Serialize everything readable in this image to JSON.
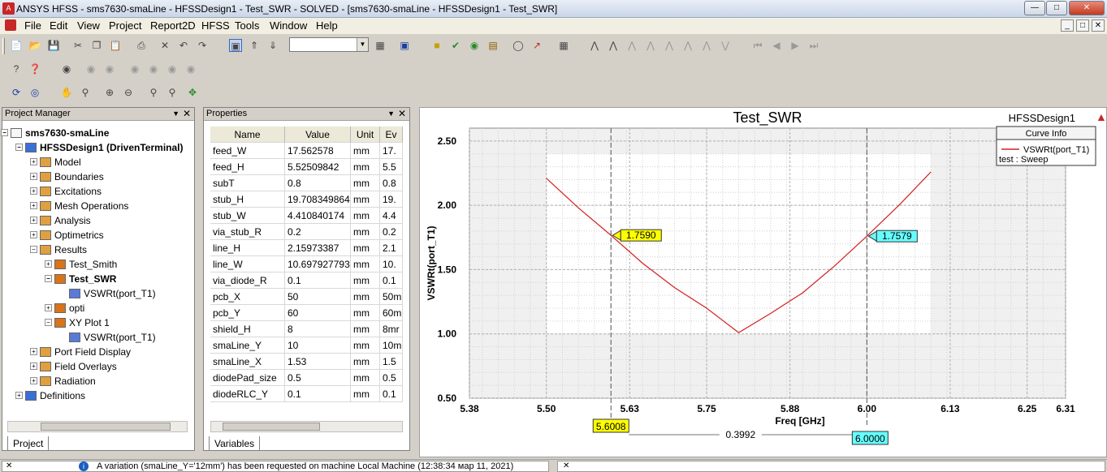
{
  "window": {
    "title": "ANSYS HFSS - sms7630-smaLine - HFSSDesign1 - Test_SWR - SOLVED - [sms7630-smaLine - HFSSDesign1 - Test_SWR]",
    "app_icon": "A"
  },
  "menu": [
    "File",
    "Edit",
    "View",
    "Project",
    "Report2D",
    "HFSS",
    "Tools",
    "Window",
    "Help"
  ],
  "project_manager": {
    "title": "Project Manager",
    "tab": "Project",
    "tree": [
      {
        "label": "sms7630-smaLine",
        "level": 0,
        "bold": true
      },
      {
        "label": "HFSSDesign1 (DrivenTerminal)",
        "level": 1,
        "bold": true
      },
      {
        "label": "Model",
        "level": 2
      },
      {
        "label": "Boundaries",
        "level": 2
      },
      {
        "label": "Excitations",
        "level": 2
      },
      {
        "label": "Mesh Operations",
        "level": 2
      },
      {
        "label": "Analysis",
        "level": 2
      },
      {
        "label": "Optimetrics",
        "level": 2
      },
      {
        "label": "Results",
        "level": 2
      },
      {
        "label": "Test_Smith",
        "level": 3
      },
      {
        "label": "Test_SWR",
        "level": 3,
        "bold": true
      },
      {
        "label": "VSWRt(port_T1)",
        "level": 4
      },
      {
        "label": "opti",
        "level": 3
      },
      {
        "label": "XY Plot 1",
        "level": 3
      },
      {
        "label": "VSWRt(port_T1)",
        "level": 4
      },
      {
        "label": "Port Field Display",
        "level": 2
      },
      {
        "label": "Field Overlays",
        "level": 2
      },
      {
        "label": "Radiation",
        "level": 2
      },
      {
        "label": "Definitions",
        "level": 1
      }
    ]
  },
  "properties": {
    "title": "Properties",
    "tab": "Variables",
    "headers": [
      "Name",
      "Value",
      "Unit",
      "Ev"
    ],
    "rows": [
      [
        "feed_W",
        "17.562578",
        "mm",
        "17."
      ],
      [
        "feed_H",
        "5.52509842",
        "mm",
        "5.5"
      ],
      [
        "subT",
        "0.8",
        "mm",
        "0.8"
      ],
      [
        "stub_H",
        "19.708349864",
        "mm",
        "19."
      ],
      [
        "stub_W",
        "4.410840174",
        "mm",
        "4.4"
      ],
      [
        "via_stub_R",
        "0.2",
        "mm",
        "0.2"
      ],
      [
        "line_H",
        "2.15973387",
        "mm",
        "2.1"
      ],
      [
        "line_W",
        "10.697927793",
        "mm",
        "10."
      ],
      [
        "via_diode_R",
        "0.1",
        "mm",
        "0.1"
      ],
      [
        "pcb_X",
        "50",
        "mm",
        "50m"
      ],
      [
        "pcb_Y",
        "60",
        "mm",
        "60m"
      ],
      [
        "shield_H",
        "8",
        "mm",
        "8mr"
      ],
      [
        "smaLine_Y",
        "10",
        "mm",
        "10m"
      ],
      [
        "smaLine_X",
        "1.53",
        "mm",
        "1.5"
      ],
      [
        "diodePad_size",
        "0.5",
        "mm",
        "0.5"
      ],
      [
        "diodeRLC_Y",
        "0.1",
        "mm",
        "0.1"
      ]
    ]
  },
  "status_bar": {
    "message": "A variation (smaLine_Y='12mm') has been requested on machine Local Machine (12:38:34 мар 11, 2021)"
  },
  "chart_data": {
    "type": "line",
    "title": "Test_SWR",
    "design_label": "HFSSDesign1",
    "xlabel": "Freq [GHz]",
    "ylabel": "VSWRt(port_T1)",
    "xlim": [
      5.38,
      6.31
    ],
    "ylim": [
      0.5,
      2.6
    ],
    "x_ticks": [
      "5.38",
      "5.50",
      "5.63",
      "5.75",
      "5.88",
      "6.00",
      "6.13",
      "6.25",
      "6.31"
    ],
    "x_tick_values": [
      5.38,
      5.5,
      5.63,
      5.75,
      5.88,
      6.0,
      6.13,
      6.25,
      6.31
    ],
    "y_ticks": [
      "0.50",
      "1.00",
      "1.50",
      "2.00",
      "2.50"
    ],
    "y_tick_values": [
      0.5,
      1.0,
      1.5,
      2.0,
      2.5
    ],
    "grid": true,
    "legend": {
      "title": "Curve Info",
      "placement": "top-right",
      "entries": [
        {
          "name": "VSWRt(port_T1)",
          "sub": "test : Sweep",
          "color": "#d32020"
        }
      ]
    },
    "series": [
      {
        "name": "VSWRt(port_T1)",
        "color": "#d32020",
        "x": [
          5.5,
          5.55,
          5.6,
          5.65,
          5.7,
          5.75,
          5.8,
          5.85,
          5.9,
          5.95,
          6.0,
          6.05,
          6.1
        ],
        "y": [
          2.21,
          1.98,
          1.77,
          1.55,
          1.36,
          1.2,
          1.01,
          1.16,
          1.32,
          1.53,
          1.76,
          2.0,
          2.26
        ]
      }
    ],
    "markers": [
      {
        "x": 5.6008,
        "label": "1.7590",
        "x_label": "5.6008",
        "color": "#ffff00"
      },
      {
        "x": 6.0,
        "label": "1.7579",
        "x_label": "6.0000",
        "color": "#66ffff"
      }
    ],
    "delta_label": "0.3992",
    "sweep_range": [
      5.5,
      6.1
    ]
  }
}
